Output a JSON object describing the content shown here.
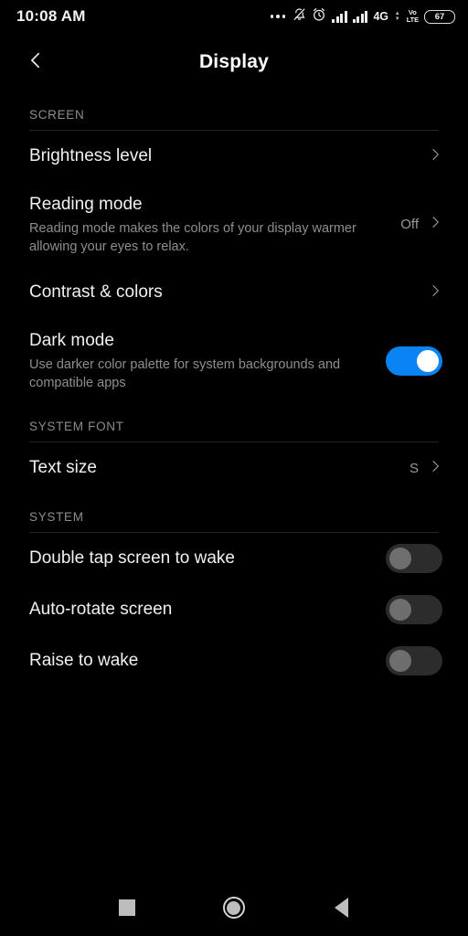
{
  "statusbar": {
    "time": "10:08 AM",
    "icons": [
      "more-dots-icon",
      "bell-muted-icon",
      "alarm-clock-icon",
      "signal-bars-icon",
      "signal-bars-icon"
    ],
    "network_label": "4G",
    "volte_top": "Vo",
    "volte_bottom": "LTE",
    "battery_percent": "67"
  },
  "appbar": {
    "back_icon": "chevron-left-icon",
    "title": "Display"
  },
  "sections": [
    {
      "header": "SCREEN",
      "rows": [
        {
          "title": "Brightness level",
          "subtitle": "",
          "value": "",
          "control": "chevron"
        },
        {
          "title": "Reading mode",
          "subtitle": "Reading mode makes the colors of your display warmer allowing your eyes to relax.",
          "value": "Off",
          "control": "chevron"
        },
        {
          "title": "Contrast & colors",
          "subtitle": "",
          "value": "",
          "control": "chevron"
        },
        {
          "title": "Dark mode",
          "subtitle": "Use darker color palette for system backgrounds and compatible apps",
          "value": "",
          "control": "toggle",
          "toggle_state": "on"
        }
      ]
    },
    {
      "header": "SYSTEM FONT",
      "rows": [
        {
          "title": "Text size",
          "subtitle": "",
          "value": "S",
          "control": "chevron"
        }
      ]
    },
    {
      "header": "SYSTEM",
      "rows": [
        {
          "title": "Double tap screen to wake",
          "subtitle": "",
          "value": "",
          "control": "toggle",
          "toggle_state": "off"
        },
        {
          "title": "Auto-rotate screen",
          "subtitle": "",
          "value": "",
          "control": "toggle",
          "toggle_state": "off"
        },
        {
          "title": "Raise to wake",
          "subtitle": "",
          "value": "",
          "control": "toggle",
          "toggle_state": "off"
        }
      ]
    }
  ],
  "navbar": {
    "recents_icon": "square-recents-icon",
    "home_icon": "circle-home-icon",
    "back_icon": "triangle-back-icon"
  },
  "colors": {
    "background": "#000000",
    "toggle_on": "#0b84f3",
    "toggle_off_track": "#2c2c2c",
    "toggle_off_knob": "#6e6e6e",
    "primary_text": "#f1f1f1",
    "secondary_text": "#8e8e8e",
    "divider": "#232323"
  }
}
